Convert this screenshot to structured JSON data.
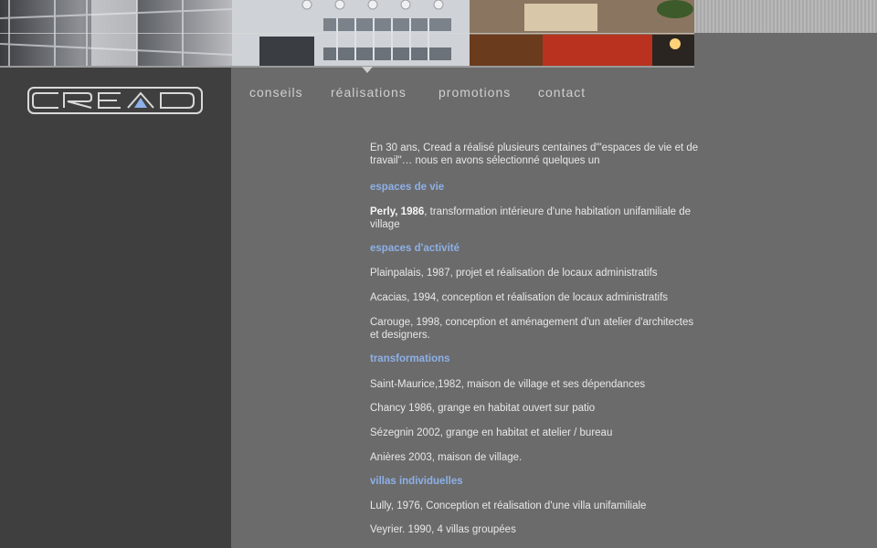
{
  "brand": {
    "logo_text": "CREAD"
  },
  "nav": {
    "items": [
      {
        "label": "conseils"
      },
      {
        "label": "réalisations"
      },
      {
        "label": "promotions"
      },
      {
        "label": "contact"
      }
    ],
    "active": "réalisations"
  },
  "content": {
    "intro": "En 30 ans, Cread a réalisé plusieurs centaines d'\"espaces de vie et  de travail\"… nous en avons sélectionné quelques un",
    "sections": [
      {
        "heading": "espaces de vie",
        "entries": [
          {
            "bold": "Perly, 1986",
            "text": ", transformation intérieure d'une habitation unifamiliale de village"
          }
        ]
      },
      {
        "heading": "espaces d'activité",
        "entries": [
          {
            "text": "Plainpalais, 1987, projet et réalisation de locaux administratifs"
          },
          {
            "text": "Acacias, 1994, conception et réalisation de locaux administratifs"
          },
          {
            "text": "Carouge, 1998, conception et aménagement d'un atelier d'architectes et designers."
          }
        ]
      },
      {
        "heading": "transformations",
        "entries": [
          {
            "text": "Saint-Maurice,1982, maison de village et ses dépendances"
          },
          {
            "text": "Chancy 1986, grange en habitat ouvert sur patio"
          },
          {
            "text": "Sézegnin 2002, grange en habitat et atelier / bureau"
          },
          {
            "text": "Anières 2003, maison de village."
          }
        ]
      },
      {
        "heading": "villas individuelles",
        "entries": [
          {
            "text": "Lully, 1976, Conception et réalisation d'une villa unifamiliale"
          },
          {
            "text": "Veyrier. 1990, 4 villas groupées"
          }
        ]
      }
    ]
  }
}
